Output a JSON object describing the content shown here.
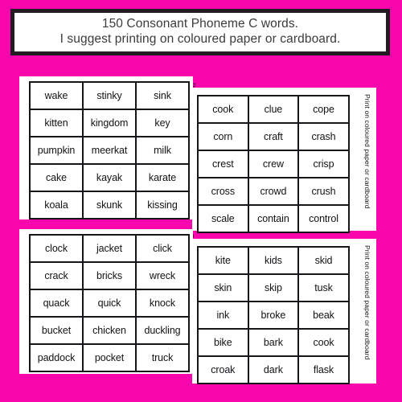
{
  "background_color": "#fa06ad",
  "header": {
    "line1": "150 Consonant Phoneme C words.",
    "line2": "I suggest printing on coloured paper or cardboard."
  },
  "side_note": {
    "text": "Print on coloured paper or cardboard",
    "fragment": "Pri"
  },
  "cards": {
    "top_left": {
      "name": "word-grid-top-left",
      "rows": [
        [
          "wake",
          "stinky",
          "sink"
        ],
        [
          "kitten",
          "kingdom",
          "key"
        ],
        [
          "pumpkin",
          "meerkat",
          "milk"
        ],
        [
          "cake",
          "kayak",
          "karate"
        ],
        [
          "koala",
          "skunk",
          "kissing"
        ]
      ]
    },
    "top_right": {
      "name": "word-grid-top-right",
      "rows": [
        [
          "cook",
          "clue",
          "cope"
        ],
        [
          "corn",
          "craft",
          "crash"
        ],
        [
          "crest",
          "crew",
          "crisp"
        ],
        [
          "cross",
          "crowd",
          "crush"
        ],
        [
          "scale",
          "contain",
          "control"
        ]
      ]
    },
    "bottom_left": {
      "name": "word-grid-bottom-left",
      "rows": [
        [
          "clock",
          "jacket",
          "click"
        ],
        [
          "crack",
          "bricks",
          "wreck"
        ],
        [
          "quack",
          "quick",
          "knock"
        ],
        [
          "bucket",
          "chicken",
          "duckling"
        ],
        [
          "paddock",
          "pocket",
          "truck"
        ]
      ]
    },
    "bottom_right": {
      "name": "word-grid-bottom-right",
      "rows": [
        [
          "kite",
          "kids",
          "skid"
        ],
        [
          "skin",
          "skip",
          "tusk"
        ],
        [
          "ink",
          "broke",
          "beak"
        ],
        [
          "bike",
          "bark",
          "cook"
        ],
        [
          "croak",
          "dark",
          "flask"
        ]
      ]
    }
  }
}
